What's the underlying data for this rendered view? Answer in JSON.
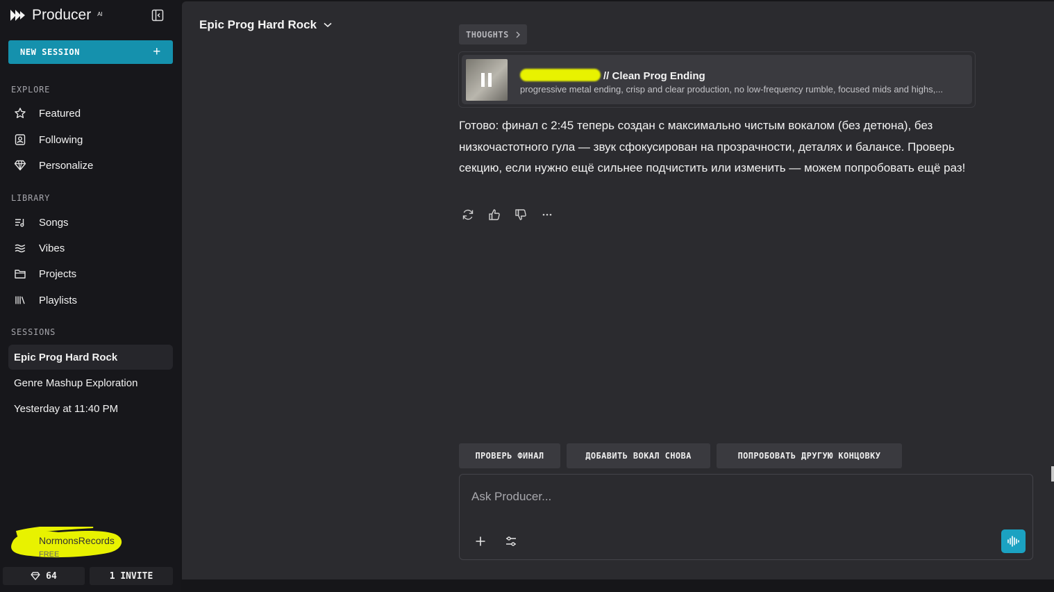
{
  "app": {
    "name": "Producer",
    "badge": "AI"
  },
  "sidebar": {
    "new_session_label": "NEW SESSION",
    "explore_label": "EXPLORE",
    "explore_items": [
      {
        "label": "Featured",
        "icon": "star-icon"
      },
      {
        "label": "Following",
        "icon": "person-badge-icon"
      },
      {
        "label": "Personalize",
        "icon": "diamond-icon"
      }
    ],
    "library_label": "LIBRARY",
    "library_items": [
      {
        "label": "Songs",
        "icon": "song-list-icon"
      },
      {
        "label": "Vibes",
        "icon": "waves-icon"
      },
      {
        "label": "Projects",
        "icon": "folder-icon"
      },
      {
        "label": "Playlists",
        "icon": "library-icon"
      }
    ],
    "sessions_label": "SESSIONS",
    "sessions": [
      {
        "label": "Epic Prog Hard Rock",
        "active": true
      },
      {
        "label": "Genre Mashup Exploration",
        "active": false
      },
      {
        "label": "Yesterday at 11:40 PM",
        "active": false
      }
    ],
    "user": {
      "name": "NormonsRecords",
      "plan": "FREE"
    },
    "credits": "64",
    "invite_label": "1 INVITE"
  },
  "main": {
    "session_title": "Epic Prog Hard Rock",
    "thoughts_label": "THOUGHTS",
    "song": {
      "title": "// Clean Prog Ending",
      "description": "progressive metal ending, crisp and clear production, no low-frequency rumble, focused mids and highs,..."
    },
    "message": "Готово: финал с 2:45 теперь создан с максимально чистым вокалом (без детюна), без низкочастотного гула — звук сфокусирован на прозрачности, деталях и балансе. Проверь секцию, если нужно ещё сильнее подчистить или изменить — можем попробовать ещё раз!",
    "suggestions": [
      "ПРОВЕРЬ ФИНАЛ",
      "ДОБАВИТЬ ВОКАЛ СНОВА",
      "ПОПРОБОВАТЬ ДРУГУЮ КОНЦОВКУ"
    ],
    "composer_placeholder": "Ask Producer..."
  },
  "colors": {
    "accent": "#1591ad",
    "voice": "#1ba2c2",
    "highlight": "#e8f200"
  }
}
